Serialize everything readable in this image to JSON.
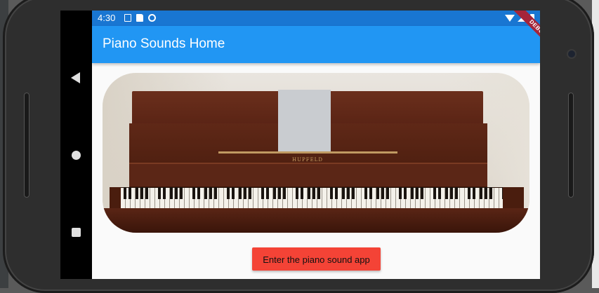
{
  "device": {
    "status_bar": {
      "time": "4:30"
    },
    "debug_banner": "DEBUG"
  },
  "app": {
    "title": "Piano Sounds Home",
    "hero_image": {
      "alt": "Upright piano",
      "brand_text": "HUPFELD"
    },
    "enter_button_label": "Enter the piano sound app"
  },
  "colors": {
    "status_bar": "#1976d2",
    "app_bar": "#2196f3",
    "button": "#f44336",
    "background": "#fafafa"
  }
}
